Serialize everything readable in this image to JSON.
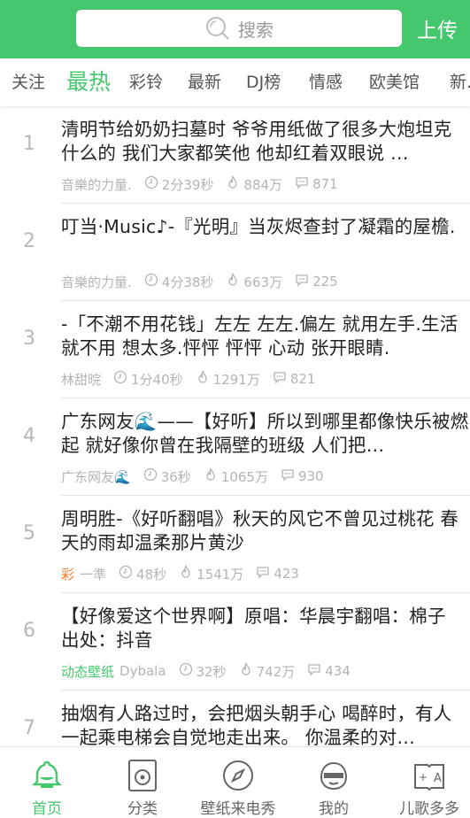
{
  "header": {
    "search_placeholder": "搜索",
    "upload_label": "上传",
    "bg_color": "#44c76d"
  },
  "tabs": [
    "关注",
    "最热",
    "彩铃",
    "最新",
    "DJ榜",
    "情感",
    "欧美馆",
    "新..."
  ],
  "active_tab": "最热",
  "items": [
    {
      "index": "1",
      "title": "清明节给奶奶扫墓时 爷爷用纸做了很多大炮坦克什么的 我们大家都笑他 他却红着双眼说 …",
      "tag": "",
      "author": "音樂的力量.",
      "duration": "2分39秒",
      "plays": "884万",
      "comments": "871"
    },
    {
      "index": "2",
      "title": "叮当·Music♪-『光明』当灰烬查封了凝霜的屋檐.",
      "tag": "",
      "author": "音樂的力量.",
      "duration": "4分38秒",
      "plays": "663万",
      "comments": "225"
    },
    {
      "index": "3",
      "title": "-「不潮不用花钱」左左 左左.偏左 就用左手.生活 就不用 想太多.怦怦 怦怦 心动 张开眼睛.",
      "tag": "",
      "author": "林甜晥",
      "duration": "1分40秒",
      "plays": "1291万",
      "comments": "821"
    },
    {
      "index": "4",
      "title": "广东网友🌊——【好听】所以到哪里都像快乐被燃起 就好像你曾在我隔壁的班级 人们把…",
      "tag": "",
      "author": "广东网友🌊",
      "duration": "36秒",
      "plays": "1065万",
      "comments": "930"
    },
    {
      "index": "5",
      "title": "周明胜-《好听翻唱》秋天的风它不曾见过桃花 春天的雨却温柔那片黄沙",
      "tag": "彩",
      "author": "一準",
      "duration": "48秒",
      "plays": "1541万",
      "comments": "423"
    },
    {
      "index": "6",
      "title": "【好像爱这个世界啊】原唱：华晨宇翻唱：棉子 出处：抖音",
      "tag": "动态壁纸",
      "author": "Dybala",
      "duration": "32秒",
      "plays": "742万",
      "comments": "434"
    },
    {
      "index": "7",
      "title": "抽烟有人路过时，会把烟头朝手心 喝醉时，有人一起乘电梯会自觉地走出来。 你温柔的对…",
      "tag": "",
      "author": "",
      "duration": "",
      "plays": "",
      "comments": ""
    }
  ],
  "bottom_nav": [
    {
      "label": "首页",
      "icon": "bell-icon"
    },
    {
      "label": "分类",
      "icon": "category-icon"
    },
    {
      "label": "壁纸来电秀",
      "icon": "compass-icon"
    },
    {
      "label": "我的",
      "icon": "face-icon"
    },
    {
      "label": "儿歌多多",
      "icon": "book-icon"
    }
  ],
  "active_nav": "首页"
}
